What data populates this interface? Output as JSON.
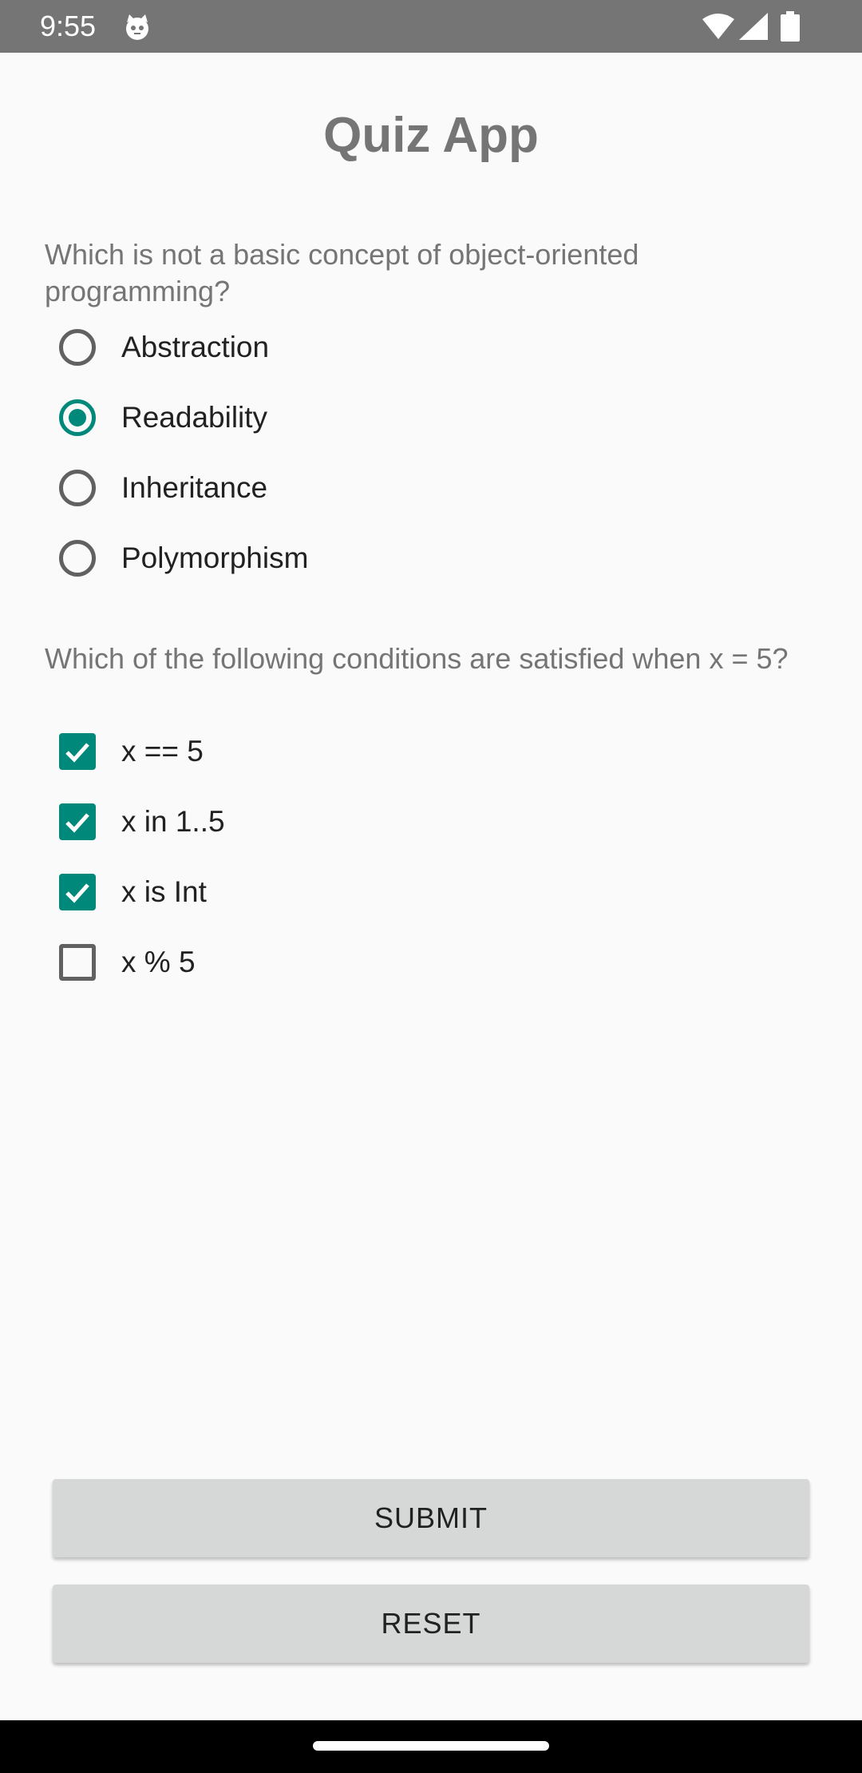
{
  "status_bar": {
    "time": "9:55",
    "app_icon": "cat-face-icon",
    "icons": [
      "wifi-icon",
      "cellular-signal-icon",
      "battery-icon"
    ]
  },
  "app": {
    "title": "Quiz App"
  },
  "question1": {
    "text": "Which is not a basic concept of object-oriented programming?",
    "type": "single-choice",
    "options": [
      {
        "label": "Abstraction",
        "checked": false
      },
      {
        "label": "Readability",
        "checked": true
      },
      {
        "label": "Inheritance",
        "checked": false
      },
      {
        "label": "Polymorphism",
        "checked": false
      }
    ]
  },
  "question2": {
    "text": "Which of the following conditions are satisfied when x = 5?",
    "type": "multiple-choice",
    "options": [
      {
        "label": "x == 5",
        "checked": true
      },
      {
        "label": "x in 1..5",
        "checked": true
      },
      {
        "label": "x is Int",
        "checked": true
      },
      {
        "label": "x % 5",
        "checked": false
      }
    ]
  },
  "buttons": {
    "submit": "SUBMIT",
    "reset": "RESET"
  },
  "colors": {
    "accent": "#00897b",
    "status_bar": "#757575",
    "button_bg": "#d6d7d7",
    "background": "#fafafa"
  }
}
